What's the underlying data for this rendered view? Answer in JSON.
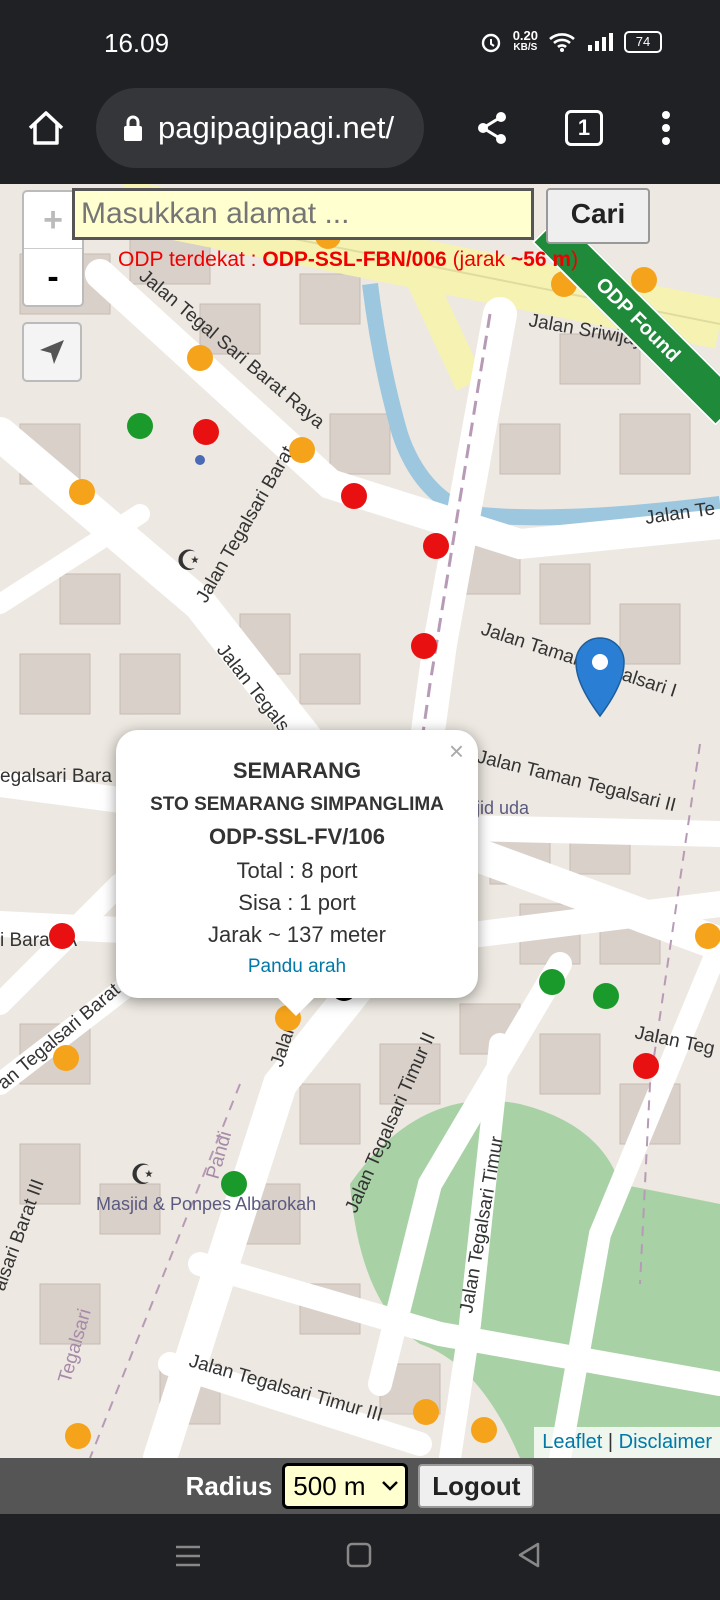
{
  "status": {
    "time": "16.09",
    "speed_value": "0.20",
    "speed_unit": "KB/S",
    "battery": "74"
  },
  "browser": {
    "url": "pagipagipagi.net/",
    "tab_count": "1"
  },
  "search": {
    "placeholder": "Masukkan alamat ...",
    "button": "Cari"
  },
  "zoom": {
    "in": "+",
    "out": "-"
  },
  "nearest": {
    "prefix": "ODP terdekat : ",
    "odp": "ODP-SSL-FBN/006",
    "mid": " (jarak ",
    "distance": "~56 m",
    "suffix": ")"
  },
  "ribbon": "ODP Found",
  "streets": [
    "Jalan Sriwijaya",
    "Jalan Tegal Sari Barat Raya",
    "Jalan Tegalsari Barat",
    "Jalan Tamam Tegalsari I",
    "Jalan Taman Tegalsari II",
    "Jalan Tegalsari Timur II",
    "Jalan Tegalsari Timur",
    "Jalan Tegalsari Timur III",
    "Jalan Te",
    "Jalan Teg",
    "Jalan Tegals",
    "egalsari Bara",
    "i Bara I A",
    "an Tegalsari Barat",
    "alsari Barat III",
    "Pandi",
    "Tegalsari",
    "Jalan Teg"
  ],
  "poi": {
    "mosque_name": "Masjid & Ponpes Albarokah",
    "mosque2": "jid uda"
  },
  "popup": {
    "region": "SEMARANG",
    "sto": "STO SEMARANG SIMPANGLIMA",
    "odp": "ODP-SSL-FV/106",
    "total": "Total : 8 port",
    "sisa": "Sisa : 1 port",
    "jarak": "Jarak ~ 137 meter",
    "link": "Pandu arah",
    "close": "×"
  },
  "attribution": {
    "leaflet": "Leaflet",
    "sep": " | ",
    "disclaimer": "Disclaimer"
  },
  "bottom": {
    "radius_label": "Radius",
    "radius_value": "500 m",
    "logout": "Logout"
  },
  "colors": {
    "marker_orange": "#f5a31a",
    "marker_red": "#e81010",
    "marker_green": "#1a9a2a",
    "marker_black": "#000000",
    "pin_blue": "#2a7fd4"
  }
}
